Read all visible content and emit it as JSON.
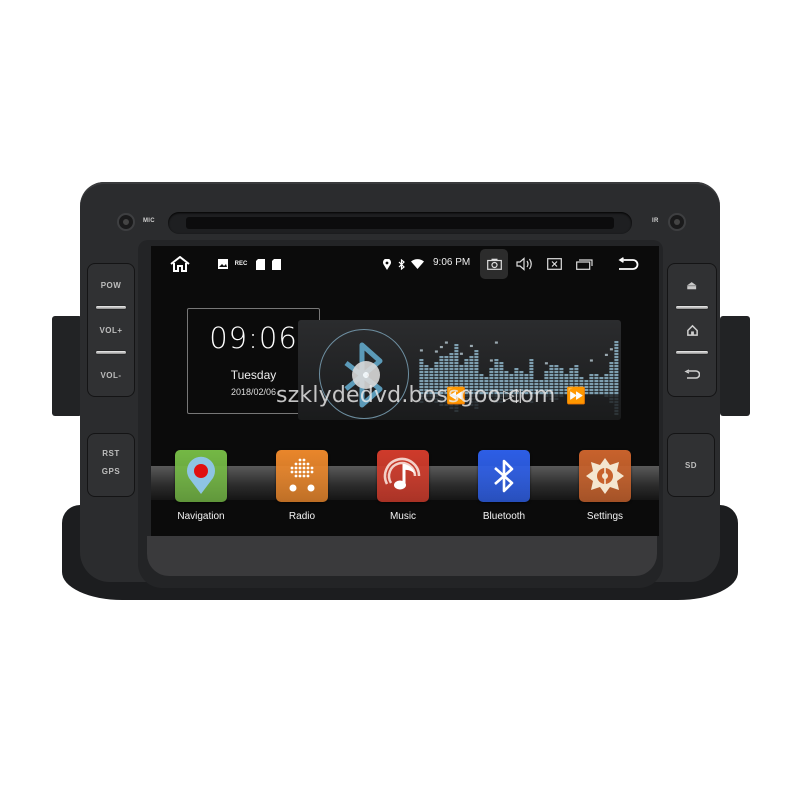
{
  "device": {
    "labels": {
      "mic": "MIC",
      "ir": "IR"
    },
    "left_buttons": [
      {
        "name": "power",
        "label": "POW"
      },
      {
        "name": "volume-up",
        "label": "VOL+"
      },
      {
        "name": "volume-down",
        "label": "VOL-"
      }
    ],
    "left_buttons_2": [
      {
        "name": "reset",
        "label": "RST"
      },
      {
        "name": "gps",
        "label": "GPS"
      }
    ],
    "right_buttons": [
      {
        "name": "eject",
        "icon": "eject-icon"
      },
      {
        "name": "home",
        "icon": "home-icon"
      },
      {
        "name": "back",
        "icon": "back-icon"
      }
    ],
    "sd_button": {
      "label": "SD"
    }
  },
  "statusbar": {
    "left_icons": [
      "home-icon",
      "gallery-icon",
      "rec-icon",
      "sd-card-icon",
      "sd-card-icon"
    ],
    "rec_text": "REC",
    "right_icons": [
      "location-icon",
      "bluetooth-icon",
      "wifi-icon"
    ],
    "time": "9:06 PM",
    "actions": [
      "screenshot-icon",
      "volume-icon",
      "close-app-icon",
      "recent-apps-icon",
      "back-icon"
    ]
  },
  "clock": {
    "time": "09:06",
    "day": "Tuesday",
    "date": "2018/02/06"
  },
  "music": {
    "source_icon": "bluetooth-icon",
    "equalizer_levels": [
      0.62,
      0.55,
      0.5,
      0.6,
      0.68,
      0.68,
      0.76,
      0.92,
      0.55,
      0.66,
      0.72,
      0.8,
      0.38,
      0.33,
      0.48,
      0.66,
      0.6,
      0.42,
      0.36,
      0.48,
      0.42,
      0.38,
      0.62,
      0.25,
      0.28,
      0.45,
      0.55,
      0.55,
      0.46,
      0.38,
      0.48,
      0.56,
      0.3,
      0.26,
      0.38,
      0.35,
      0.3,
      0.4,
      0.6,
      0.95
    ],
    "equalizer_peaks": [
      0.78,
      null,
      null,
      0.76,
      0.84,
      0.92,
      null,
      null,
      0.72,
      null,
      0.86,
      null,
      null,
      null,
      0.6,
      0.92,
      null,
      null,
      null,
      null,
      null,
      null,
      null,
      null,
      null,
      0.55,
      null,
      null,
      null,
      null,
      null,
      null,
      null,
      null,
      0.6,
      null,
      null,
      0.7,
      0.8,
      null
    ],
    "controls": [
      {
        "name": "previous",
        "glyph": "⏪"
      },
      {
        "name": "play-pause",
        "glyph": "▷||"
      },
      {
        "name": "next",
        "glyph": "⏩"
      }
    ]
  },
  "apps": [
    {
      "name": "navigation",
      "label": "Navigation",
      "color": "#74b845"
    },
    {
      "name": "radio",
      "label": "Radio",
      "color": "#e9862b"
    },
    {
      "name": "music",
      "label": "Music",
      "color": "#cf3b2b"
    },
    {
      "name": "bluetooth",
      "label": "Bluetooth",
      "color": "#2d5ee6"
    },
    {
      "name": "settings",
      "label": "Settings",
      "color": "#c8622c"
    }
  ],
  "watermark": "szklydedvd.bossgoo.com"
}
